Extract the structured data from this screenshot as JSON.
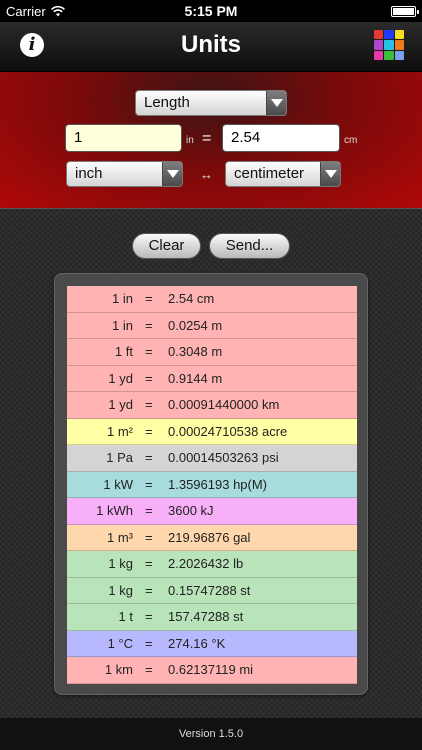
{
  "status": {
    "carrier": "Carrier",
    "time": "5:15 PM"
  },
  "nav": {
    "title": "Units",
    "info_glyph": "i",
    "grid_colors": [
      "#e53935",
      "#1e3cff",
      "#f5e11f",
      "#b046c8",
      "#25c2e6",
      "#f07a1a",
      "#e63aa8",
      "#3bbf3b",
      "#7aa0f0"
    ]
  },
  "converter": {
    "category": "Length",
    "from_value": "1",
    "from_unit_short": "in",
    "equals": "=",
    "to_value": "2.54",
    "to_unit_short": "cm",
    "from_unit": "inch",
    "swap": "↔",
    "to_unit": "centimeter"
  },
  "actions": {
    "clear": "Clear",
    "send": "Send..."
  },
  "results": [
    {
      "lhs": "1 in",
      "rhs": "2.54 cm",
      "color": "#ffb3b3"
    },
    {
      "lhs": "1 in",
      "rhs": "0.0254 m",
      "color": "#ffb3b3"
    },
    {
      "lhs": "1 ft",
      "rhs": "0.3048 m",
      "color": "#ffb3b3"
    },
    {
      "lhs": "1 yd",
      "rhs": "0.9144 m",
      "color": "#ffb3b3"
    },
    {
      "lhs": "1 yd",
      "rhs": "0.00091440000 km",
      "color": "#ffb3b3"
    },
    {
      "lhs": "1 m²",
      "rhs": "0.00024710538 acre",
      "color": "#ffffa6"
    },
    {
      "lhs": "1 Pa",
      "rhs": "0.00014503263 psi",
      "color": "#d4d4d4"
    },
    {
      "lhs": "1 kW",
      "rhs": "1.3596193 hp(M)",
      "color": "#a8dcdc"
    },
    {
      "lhs": "1 kWh",
      "rhs": "3600 kJ",
      "color": "#f7b0f7"
    },
    {
      "lhs": "1 m³",
      "rhs": "219.96876 gal",
      "color": "#ffd7ad"
    },
    {
      "lhs": "1 kg",
      "rhs": "2.2026432 lb",
      "color": "#b9e3b9"
    },
    {
      "lhs": "1 kg",
      "rhs": "0.15747288 st",
      "color": "#b9e3b9"
    },
    {
      "lhs": "1 t",
      "rhs": "157.47288 st",
      "color": "#b9e3b9"
    },
    {
      "lhs": "1 °C",
      "rhs": "274.16 °K",
      "color": "#b8b8ff"
    },
    {
      "lhs": "1 km",
      "rhs": "0.62137119 mi",
      "color": "#ffb3b3"
    }
  ],
  "eq_sign": "=",
  "version": "Version 1.5.0"
}
